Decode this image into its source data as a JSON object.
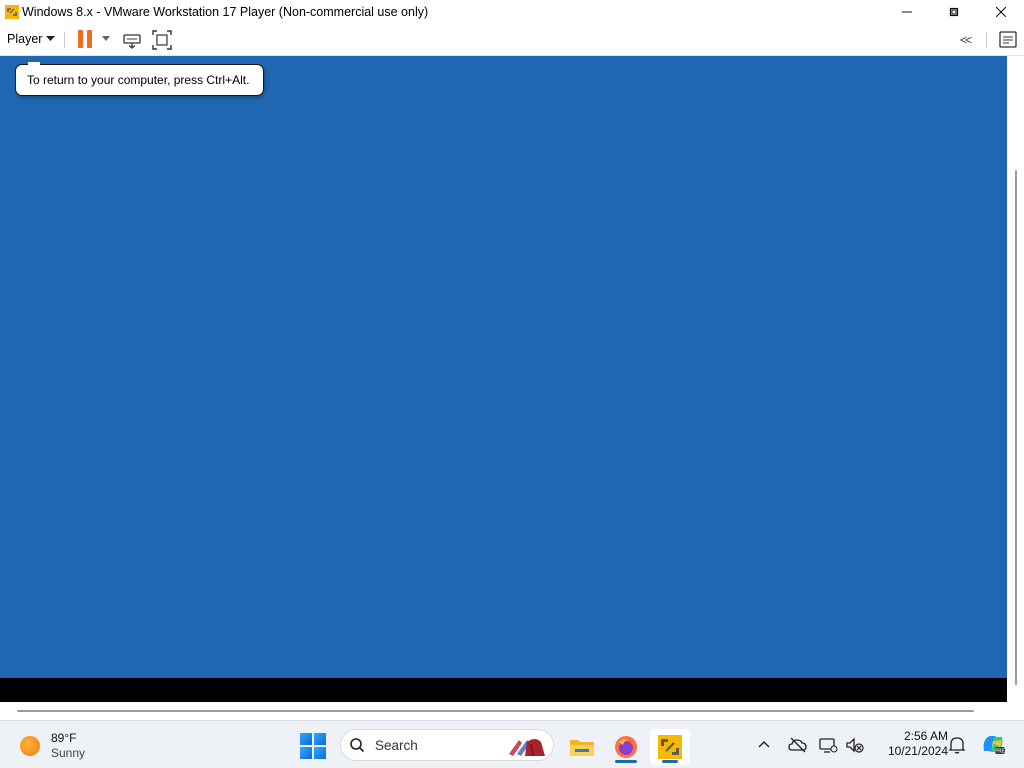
{
  "window": {
    "title": "Windows 8.x - VMware Workstation 17 Player (Non-commercial use only)",
    "controls": {
      "minimize": "—",
      "maximize": "❐",
      "close": "✕"
    }
  },
  "toolbar": {
    "player_menu": "Player",
    "unity_chevron": "<<"
  },
  "tooltip": {
    "text": "To return to your computer, press Ctrl+Alt."
  },
  "colors": {
    "vm_background": "#1f67b1",
    "pause_orange": "#f26b21"
  },
  "taskbar": {
    "weather": {
      "temp": "89°F",
      "condition": "Sunny"
    },
    "search_placeholder": "Search",
    "clock": {
      "time": "2:56 AM",
      "date": "10/21/2024"
    },
    "apps": [
      "file-explorer",
      "firefox",
      "vmware-player"
    ]
  }
}
